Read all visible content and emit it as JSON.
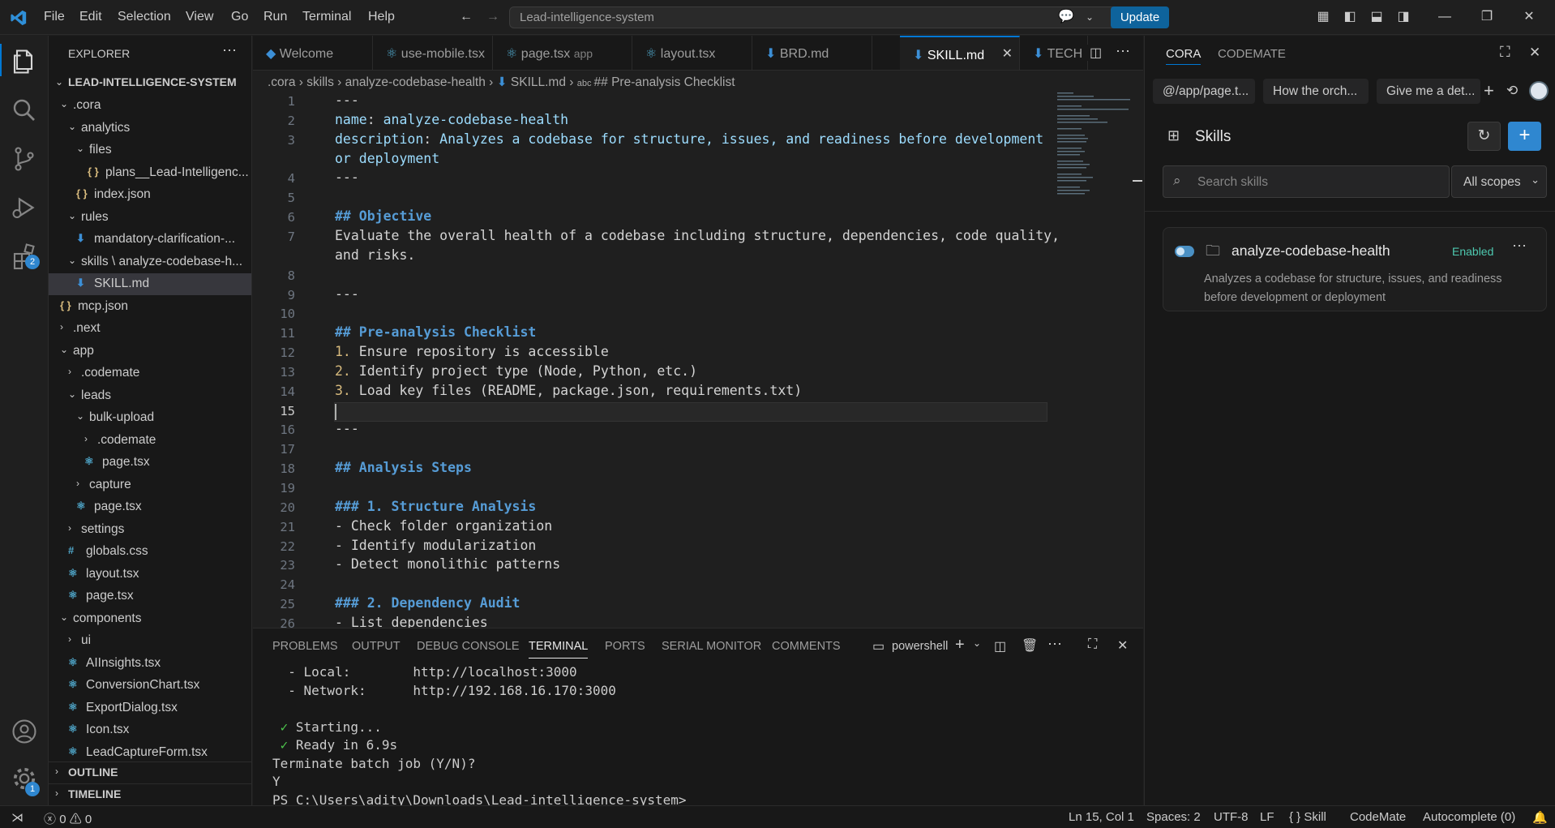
{
  "titlebar": {
    "menu": [
      "File",
      "Edit",
      "Selection",
      "View",
      "Go",
      "Run",
      "Terminal",
      "Help"
    ],
    "search_text": "Lead-intelligence-system",
    "update_label": "Update"
  },
  "activity": {
    "extensions_badge": "2",
    "settings_badge": "1"
  },
  "explorer": {
    "title": "EXPLORER",
    "root": "LEAD-INTELLIGENCE-SYSTEM",
    "items": [
      {
        "label": ".cora",
        "icon": "chevron-down"
      },
      {
        "label": "analytics",
        "icon": "chevron-down"
      },
      {
        "label": "files",
        "icon": "chevron-down"
      },
      {
        "label": "plans__Lead-Intelligenc...",
        "icon": "json"
      },
      {
        "label": "index.json",
        "icon": "json"
      },
      {
        "label": "rules",
        "icon": "chevron-down"
      },
      {
        "label": "mandatory-clarification-...",
        "icon": "md"
      },
      {
        "label": "skills \\ analyze-codebase-h...",
        "icon": "chevron-down"
      },
      {
        "label": "SKILL.md",
        "icon": "md"
      },
      {
        "label": "mcp.json",
        "icon": "json"
      },
      {
        "label": ".next",
        "icon": "chevron-right"
      },
      {
        "label": "app",
        "icon": "chevron-down"
      },
      {
        "label": ".codemate",
        "icon": "chevron-right"
      },
      {
        "label": "leads",
        "icon": "chevron-down"
      },
      {
        "label": "bulk-upload",
        "icon": "chevron-down"
      },
      {
        "label": ".codemate",
        "icon": "chevron-right"
      },
      {
        "label": "page.tsx",
        "icon": "tsx"
      },
      {
        "label": "capture",
        "icon": "chevron-right"
      },
      {
        "label": "page.tsx",
        "icon": "tsx"
      },
      {
        "label": "settings",
        "icon": "chevron-right"
      },
      {
        "label": "globals.css",
        "icon": "css"
      },
      {
        "label": "layout.tsx",
        "icon": "tsx"
      },
      {
        "label": "page.tsx",
        "icon": "tsx"
      },
      {
        "label": "components",
        "icon": "chevron-down"
      },
      {
        "label": "ui",
        "icon": "chevron-right"
      },
      {
        "label": "AIInsights.tsx",
        "icon": "tsx"
      },
      {
        "label": "ConversionChart.tsx",
        "icon": "tsx"
      },
      {
        "label": "ExportDialog.tsx",
        "icon": "tsx"
      },
      {
        "label": "Icon.tsx",
        "icon": "tsx"
      },
      {
        "label": "LeadCaptureForm.tsx",
        "icon": "tsx"
      }
    ],
    "outline": "OUTLINE",
    "timeline": "TIMELINE"
  },
  "tabs": [
    {
      "label": "Welcome",
      "sub": ""
    },
    {
      "label": "use-mobile.tsx",
      "sub": ""
    },
    {
      "label": "page.tsx",
      "sub": "app"
    },
    {
      "label": "layout.tsx",
      "sub": ""
    },
    {
      "label": "BRD.md",
      "sub": ""
    },
    {
      "label": "SKILL.md",
      "sub": ""
    },
    {
      "label": "TECH",
      "sub": ""
    }
  ],
  "breadcrumb": [
    ".cora",
    "skills",
    "analyze-codebase-health",
    "SKILL.md",
    "## Pre-analysis Checklist"
  ],
  "editor": {
    "lines": [
      {
        "n": "1",
        "t": "---"
      },
      {
        "n": "2",
        "k": "name",
        "v": "analyze-codebase-health"
      },
      {
        "n": "3",
        "k": "description",
        "v": "Analyzes a codebase for structure, issues, and readiness before development"
      },
      {
        "n": "",
        "v": "or deployment"
      },
      {
        "n": "4",
        "t": "---"
      },
      {
        "n": "5",
        "t": ""
      },
      {
        "n": "6",
        "h": "## Objective"
      },
      {
        "n": "7",
        "t": "Evaluate the overall health of a codebase including structure, dependencies, code quality,"
      },
      {
        "n": "",
        "t": "and risks."
      },
      {
        "n": "8",
        "t": ""
      },
      {
        "n": "9",
        "t": "---"
      },
      {
        "n": "10",
        "t": ""
      },
      {
        "n": "11",
        "h": "## Pre-analysis Checklist"
      },
      {
        "n": "12",
        "num": "1.",
        "t": " Ensure repository is accessible"
      },
      {
        "n": "13",
        "num": "2.",
        "t": " Identify project type (Node, Python, etc.)"
      },
      {
        "n": "14",
        "num": "3.",
        "t": " Load key files (README, package.json, requirements.txt)"
      },
      {
        "n": "15",
        "t": ""
      },
      {
        "n": "16",
        "t": "---"
      },
      {
        "n": "17",
        "t": ""
      },
      {
        "n": "18",
        "h": "## Analysis Steps"
      },
      {
        "n": "19",
        "t": ""
      },
      {
        "n": "20",
        "h": "### 1. Structure Analysis"
      },
      {
        "n": "21",
        "t": "- Check folder organization"
      },
      {
        "n": "22",
        "t": "- Identify modularization"
      },
      {
        "n": "23",
        "t": "- Detect monolithic patterns"
      },
      {
        "n": "24",
        "t": ""
      },
      {
        "n": "25",
        "h": "### 2. Dependency Audit"
      },
      {
        "n": "26",
        "t": "- List dependencies"
      }
    ]
  },
  "panel": {
    "tabs": [
      "PROBLEMS",
      "OUTPUT",
      "DEBUG CONSOLE",
      "TERMINAL",
      "PORTS",
      "SERIAL MONITOR",
      "COMMENTS"
    ],
    "shell": "powershell",
    "lines": [
      "  - Local:        http://localhost:3000",
      "  - Network:      http://192.168.16.170:3000",
      "",
      " ✓ Starting...",
      " ✓ Ready in 6.9s",
      "Terminate batch job (Y/N)?",
      "Y",
      "PS C:\\Users\\adity\\Downloads\\Lead-intelligence-system>"
    ]
  },
  "right": {
    "tabs": [
      "CORA",
      "CODEMATE"
    ],
    "chips": [
      "@/app/page.t...",
      "How the orch...",
      "Give me a det..."
    ],
    "skills_title": "Skills",
    "search_placeholder": "Search skills",
    "scope": "All scopes",
    "skill": {
      "name": "analyze-codebase-health",
      "status": "Enabled",
      "description": "Analyzes a codebase for structure, issues, and readiness before development or deployment"
    }
  },
  "status": {
    "errors": "0",
    "warnings": "0",
    "position": "Ln 15, Col 1",
    "spaces": "Spaces: 2",
    "encoding": "UTF-8",
    "eol": "LF",
    "mode": "Skill",
    "ext": "CodeMate",
    "autocomplete": "Autocomplete (0)"
  }
}
